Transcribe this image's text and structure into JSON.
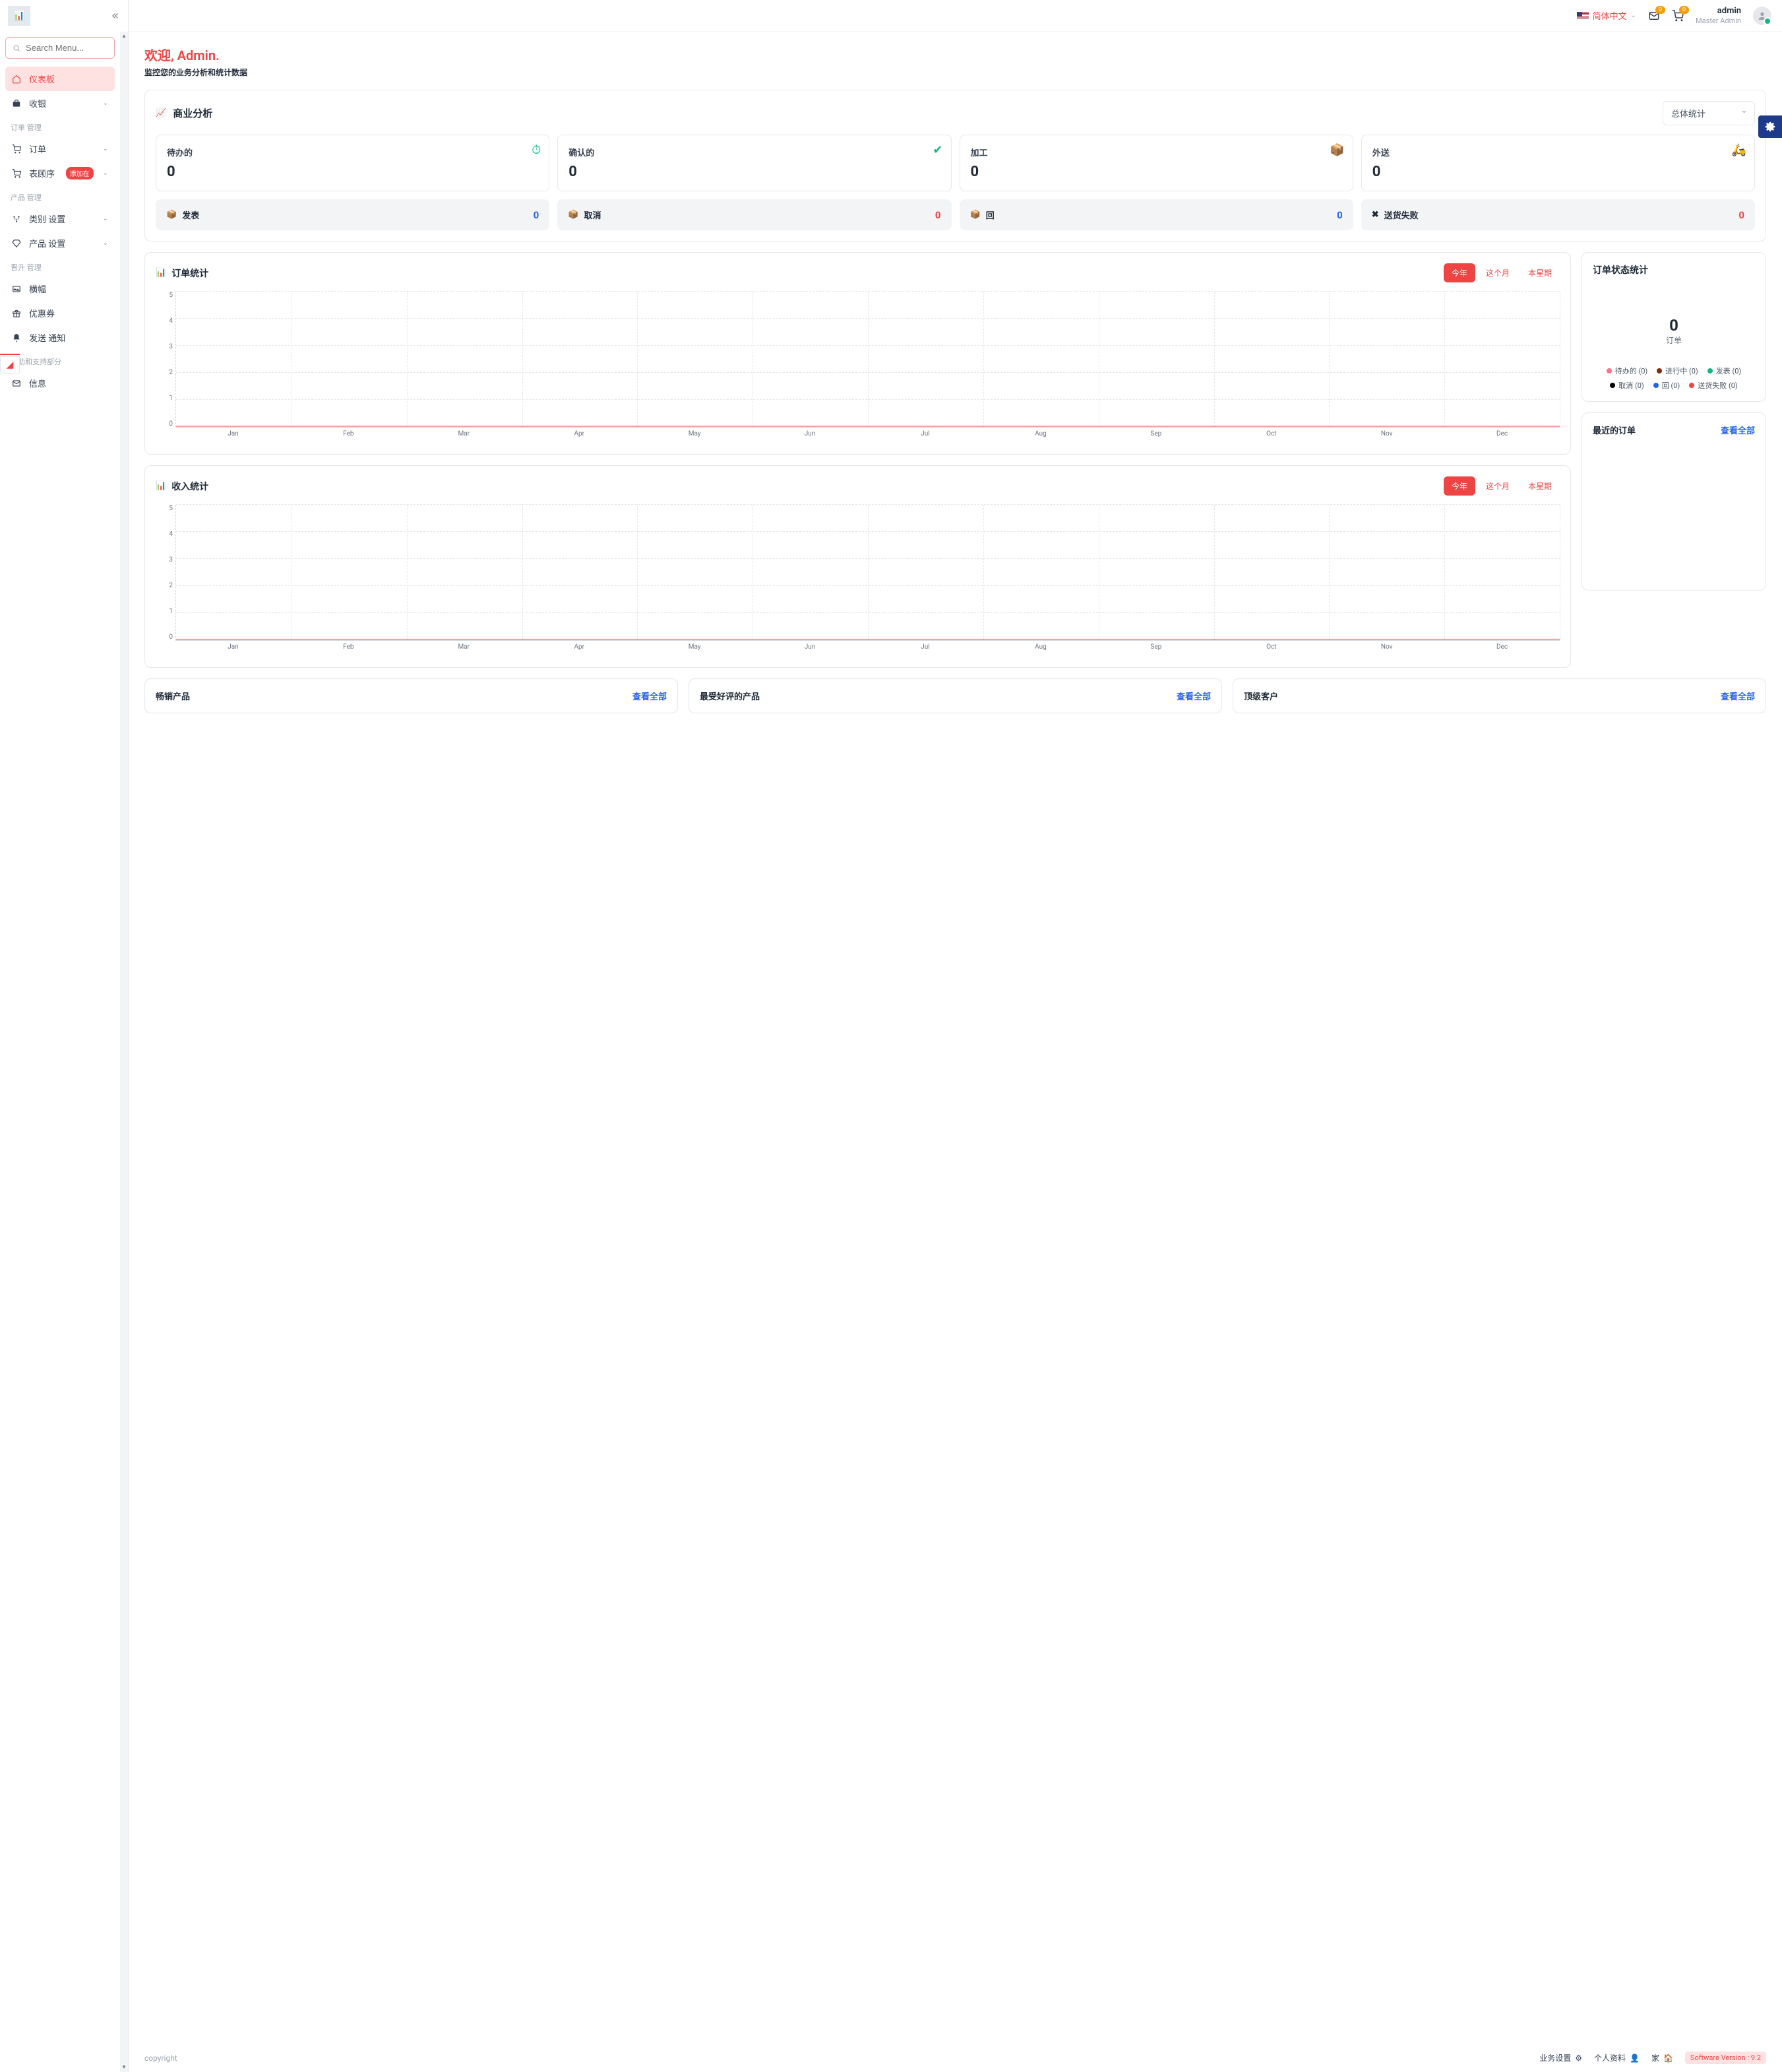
{
  "header": {
    "language": "简体中文",
    "mail_badge": "0",
    "cart_badge": "0",
    "user_name": "admin",
    "user_role": "Master Admin"
  },
  "search": {
    "placeholder": "Search Menu..."
  },
  "sidebar": {
    "items": [
      {
        "label": "仪表板",
        "icon": "home-icon",
        "active": true
      },
      {
        "label": "收银",
        "icon": "briefcase-icon",
        "expandable": true
      }
    ],
    "groups": [
      {
        "label": "订单 管理",
        "items": [
          {
            "label": "订单",
            "icon": "cart-icon",
            "expandable": true
          },
          {
            "label": "表顾序",
            "icon": "cart-icon",
            "badge": "添加在",
            "expandable": true
          }
        ]
      },
      {
        "label": "产品 管理",
        "items": [
          {
            "label": "类别 设置",
            "icon": "sitemap-icon",
            "expandable": true
          },
          {
            "label": "产品 设置",
            "icon": "diamond-icon",
            "expandable": true
          }
        ]
      },
      {
        "label": "晋升 管理",
        "items": [
          {
            "label": "横幅",
            "icon": "image-icon"
          },
          {
            "label": "优惠券",
            "icon": "gift-icon"
          },
          {
            "label": "发送 通知",
            "icon": "bell-icon"
          }
        ]
      },
      {
        "label": "帮助和支持部分",
        "items": [
          {
            "label": "信息",
            "icon": "mail-icon"
          }
        ]
      }
    ]
  },
  "welcome": {
    "title": "欢迎, Admin.",
    "subtitle": "监控您的业务分析和统计数据"
  },
  "analytics": {
    "title": "商业分析",
    "select": "总体统计",
    "top": [
      {
        "label": "待办的",
        "value": "0",
        "icon": "⏱",
        "color": "#10b981"
      },
      {
        "label": "确认的",
        "value": "0",
        "icon": "✔",
        "color": "#10b981"
      },
      {
        "label": "加工",
        "value": "0",
        "icon": "📦",
        "color": "#d97706"
      },
      {
        "label": "外送",
        "value": "0",
        "icon": "🛵",
        "color": "#ef4444"
      }
    ],
    "bottom": [
      {
        "label": "发表",
        "value": "0",
        "icon": "📦",
        "color_class": "c-blue"
      },
      {
        "label": "取消",
        "value": "0",
        "icon": "📦",
        "color_class": "c-red"
      },
      {
        "label": "回",
        "value": "0",
        "icon": "📦",
        "color_class": "c-blue"
      },
      {
        "label": "送货失败",
        "value": "0",
        "icon": "✖",
        "color_class": "c-red"
      }
    ]
  },
  "chart_data": [
    {
      "type": "line",
      "title": "订单统计",
      "segments": [
        "今年",
        "这个月",
        "本星期"
      ],
      "active_segment": "今年",
      "categories": [
        "Jan",
        "Feb",
        "Mar",
        "Apr",
        "May",
        "Jun",
        "Jul",
        "Aug",
        "Sep",
        "Oct",
        "Nov",
        "Dec"
      ],
      "values": [
        0,
        0,
        0,
        0,
        0,
        0,
        0,
        0,
        0,
        0,
        0,
        0
      ],
      "ylim": [
        0,
        5
      ],
      "yticks": [
        0,
        1,
        2,
        3,
        4,
        5
      ],
      "series_color": "#ef4444"
    },
    {
      "type": "line",
      "title": "收入统计",
      "segments": [
        "今年",
        "这个月",
        "本星期"
      ],
      "active_segment": "今年",
      "categories": [
        "Jan",
        "Feb",
        "Mar",
        "Apr",
        "May",
        "Jun",
        "Jul",
        "Aug",
        "Sep",
        "Oct",
        "Nov",
        "Dec"
      ],
      "values": [
        0,
        0,
        0,
        0,
        0,
        0,
        0,
        0,
        0,
        0,
        0,
        0
      ],
      "ylim": [
        0,
        5
      ],
      "yticks": [
        0,
        1,
        2,
        3,
        4,
        5
      ],
      "series_color": "#ef4444"
    }
  ],
  "status": {
    "title": "订单状态统计",
    "big_value": "0",
    "big_label": "订单",
    "legend": [
      {
        "label": "待办的 (0)",
        "color": "#fb7185"
      },
      {
        "label": "进行中 (0)",
        "color": "#7c2d12"
      },
      {
        "label": "发表 (0)",
        "color": "#10b981"
      },
      {
        "label": "取消 (0)",
        "color": "#000000"
      },
      {
        "label": "回 (0)",
        "color": "#2563eb"
      },
      {
        "label": "送货失败 (0)",
        "color": "#ef4444"
      }
    ]
  },
  "recent": {
    "title": "最近的订单",
    "view_all": "查看全部"
  },
  "bottom_cards": [
    {
      "title": "畅销产品",
      "view_all": "查看全部"
    },
    {
      "title": "最受好评的产品",
      "view_all": "查看全部"
    },
    {
      "title": "顶级客户",
      "view_all": "查看全部"
    }
  ],
  "footer": {
    "copyright": "copyright",
    "links": [
      {
        "label": "业务设置",
        "icon": "⚙"
      },
      {
        "label": "个人资料",
        "icon": "👤"
      },
      {
        "label": "家",
        "icon": "🏠"
      }
    ],
    "version": "Software Version : 9.2"
  }
}
